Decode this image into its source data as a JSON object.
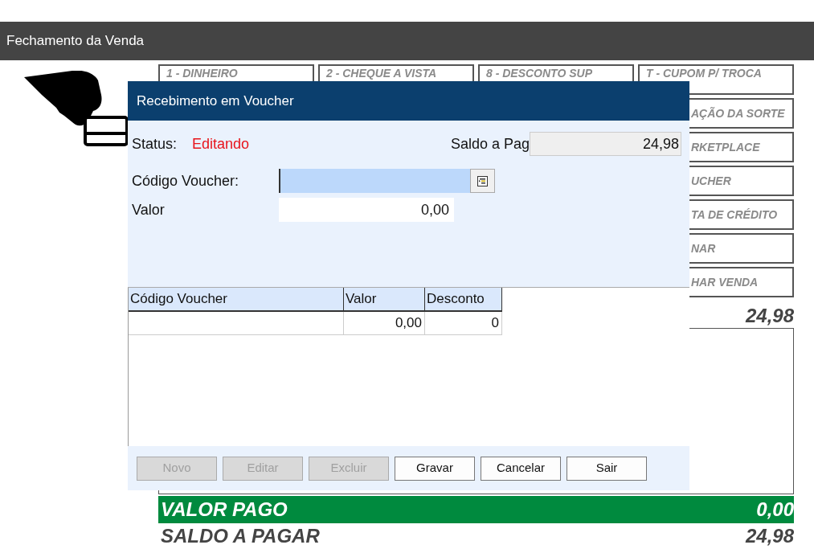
{
  "window": {
    "title": "Fechamento da Venda"
  },
  "payment_buttons": [
    {
      "label": "1 - DINHEIRO",
      "kind": "full"
    },
    {
      "label": "2 - CHEQUE A VISTA",
      "kind": "full"
    },
    {
      "label": "8 - DESCONTO SUP",
      "kind": "full"
    },
    {
      "label": "T - CUPOM P/ TROCA",
      "kind": "full"
    },
    {
      "label": "AÇÃO DA SORTE",
      "kind": "partial"
    },
    {
      "label": "RKETPLACE",
      "kind": "partial"
    },
    {
      "label": "UCHER",
      "kind": "partial"
    },
    {
      "label": "TA DE CRÉDITO",
      "kind": "partial"
    },
    {
      "label": "NAR",
      "kind": "partial"
    },
    {
      "label": "HAR VENDA",
      "kind": "partial"
    }
  ],
  "total": "24,98",
  "valor_pago": {
    "label": "VALOR PAGO",
    "value": "0,00"
  },
  "saldo_a_pagar": {
    "label": "SALDO A PAGAR",
    "value": "24,98"
  },
  "dialog": {
    "title": "Recebimento em Voucher",
    "status_label": "Status:",
    "status_value": "Editando",
    "saldo_label": "Saldo a Pag",
    "saldo_value": "24,98",
    "fields": [
      {
        "label": "Código Voucher:",
        "kind": "lookup",
        "focused": true
      },
      {
        "label": "Valor",
        "value": "0,00",
        "kind": "plain",
        "focused": false
      }
    ],
    "grid": {
      "columns": [
        "Código Voucher",
        "Valor",
        "Desconto"
      ],
      "rows": [
        {
          "valor": "0,00",
          "desconto": "0"
        }
      ]
    },
    "buttons": [
      {
        "label": "Novo",
        "disabled": true
      },
      {
        "label": "Editar",
        "disabled": true
      },
      {
        "label": "Excluir",
        "disabled": true
      },
      {
        "label": "Gravar",
        "disabled": false
      },
      {
        "label": "Cancelar",
        "disabled": false
      },
      {
        "label": "Sair",
        "disabled": false
      }
    ]
  }
}
